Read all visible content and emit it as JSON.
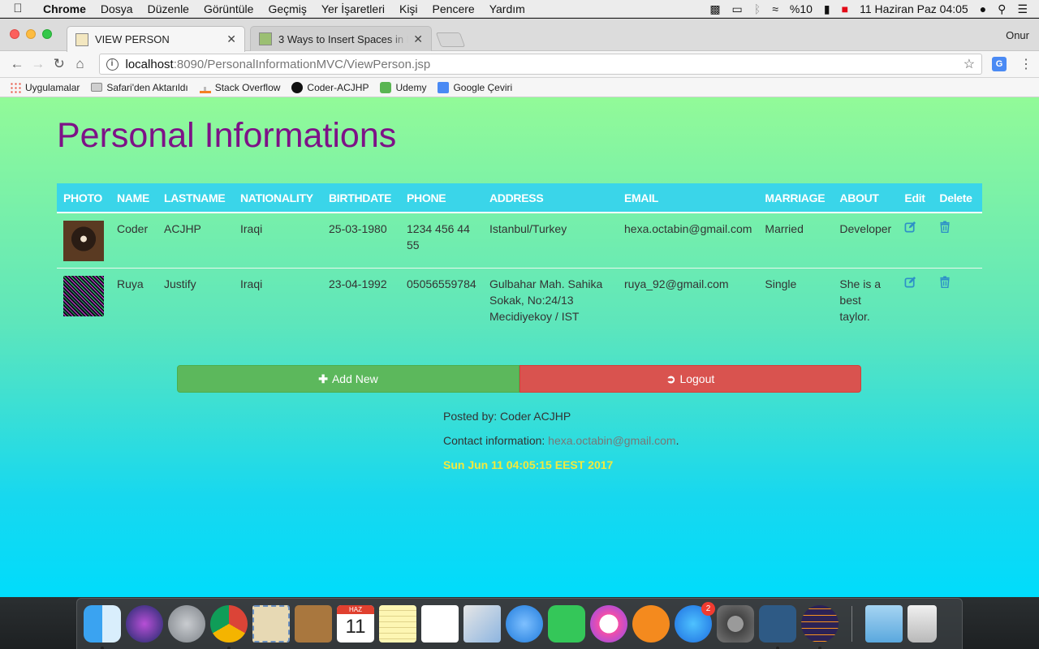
{
  "menubar": {
    "app": "Chrome",
    "items": [
      "Dosya",
      "Düzenle",
      "Görüntüle",
      "Geçmiş",
      "Yer İşaretleri",
      "Kişi",
      "Pencere",
      "Yardım"
    ],
    "battery": "%10",
    "datetime": "11 Haziran Paz  04:05"
  },
  "browser": {
    "tabs": [
      {
        "title": "VIEW PERSON"
      },
      {
        "title": "3 Ways to Insert Spaces in HTML"
      }
    ],
    "profile": "Onur",
    "url_host": "localhost",
    "url_rest": ":8090/PersonalInformationMVC/ViewPerson.jsp",
    "bookmarks": [
      "Uygulamalar",
      "Safari'den Aktarıldı",
      "Stack Overflow",
      "Coder-ACJHP",
      "Udemy",
      "Google Çeviri"
    ]
  },
  "page": {
    "title": "Personal Informations",
    "columns": [
      "PHOTO",
      "NAME",
      "LASTNAME",
      "NATIONALITY",
      "BIRTHDATE",
      "PHONE",
      "ADDRESS",
      "EMAIL",
      "MARRIAGE",
      "ABOUT",
      "Edit",
      "Delete"
    ],
    "rows": [
      {
        "name": "Coder",
        "lastname": "ACJHP",
        "nationality": "Iraqi",
        "birthdate": "25-03-1980",
        "phone": "1234 456 44 55",
        "address": "Istanbul/Turkey",
        "email": "hexa.octabin@gmail.com",
        "marriage": "Married",
        "about": "Developer"
      },
      {
        "name": "Ruya",
        "lastname": "Justify",
        "nationality": "Iraqi",
        "birthdate": "23-04-1992",
        "phone": "05056559784",
        "address": "Gulbahar Mah. Sahika Sokak, No:24/13 Mecidiyekoy / IST",
        "email": "ruya_92@gmail.com",
        "marriage": "Single",
        "about": "She is a best taylor."
      }
    ],
    "add_button": "Add New",
    "logout_button": "Logout",
    "footer": {
      "posted_by": "Posted by: Coder ACJHP",
      "contact_label": "Contact information: ",
      "contact_email": "hexa.octabin@gmail.com",
      "contact_suffix": ".",
      "date": "Sun Jun 11 04:05:15 EEST 2017"
    }
  },
  "dock": {
    "calendar_month": "HAZ",
    "calendar_day": "11",
    "appstore_badge": "2"
  },
  "colors": {
    "title": "#7d1287",
    "header_bg": "#3ad5e9",
    "add_btn": "#5cb85c",
    "logout_btn": "#d9534f",
    "date_text": "#f4ea3b"
  }
}
